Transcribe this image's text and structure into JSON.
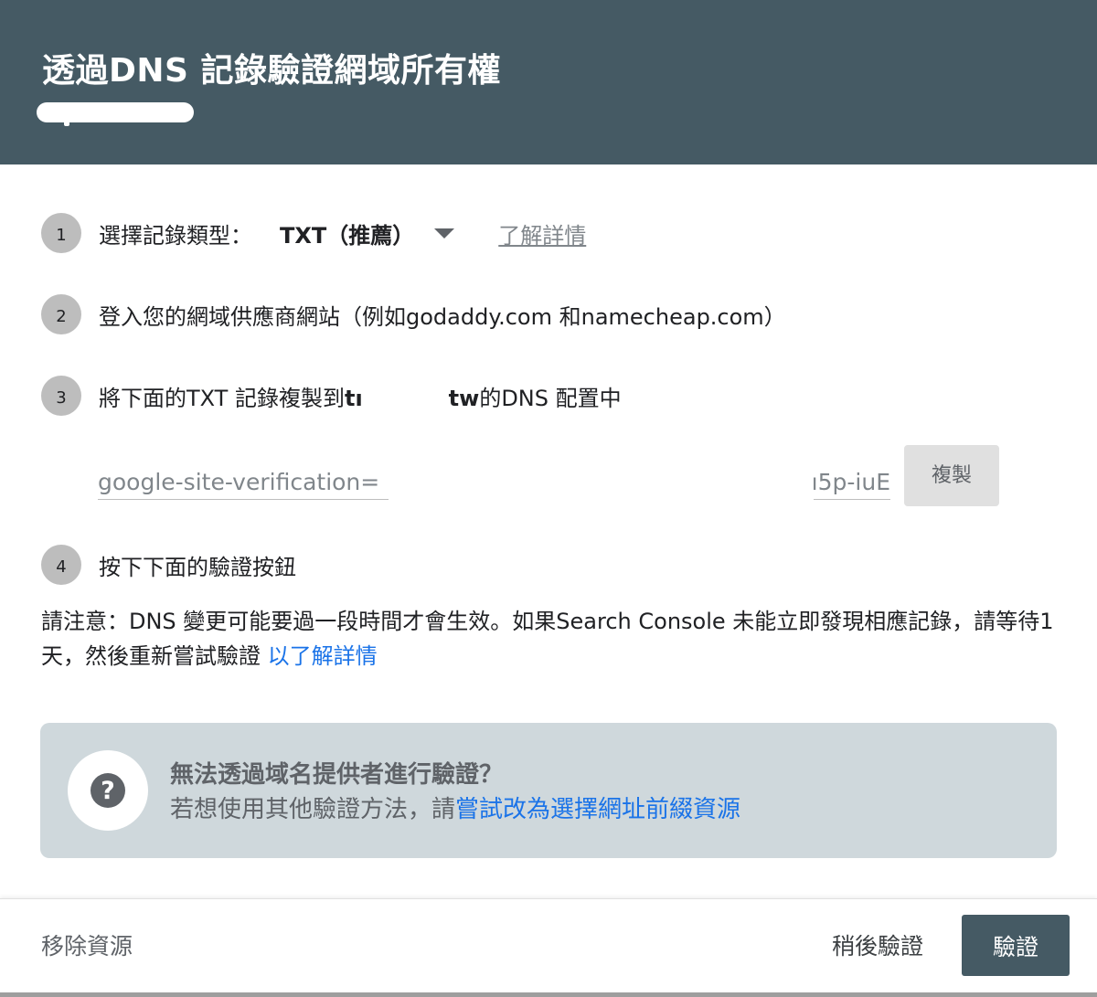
{
  "header": {
    "title": "透過DNS 記錄驗證網域所有權"
  },
  "steps": {
    "step1": {
      "number": "1",
      "label": "選擇記錄類型：",
      "record_type": "TXT（推薦）",
      "learn_more": "了解詳情"
    },
    "step2": {
      "number": "2",
      "label": "登入您的網域供應商網站（例如godaddy.com 和namecheap.com）"
    },
    "step3": {
      "number": "3",
      "label_prefix": "將下面的TXT 記錄複製到",
      "domain_start": "tı",
      "domain_end": "tw",
      "label_suffix": "的DNS 配置中",
      "record_prefix": "google-site-verification=",
      "record_suffix": "ı5p-iuE",
      "copy_label": "複製"
    },
    "step4": {
      "number": "4",
      "label": "按下下面的驗證按鈕"
    }
  },
  "note": {
    "text": "請注意：DNS 變更可能要過一段時間才會生效。如果Search Console 未能立即發現相應記錄，請等待1 天，然後重新嘗試驗證 ",
    "link": "以了解詳情"
  },
  "help": {
    "icon": "?",
    "title": "無法透過域名提供者進行驗證？",
    "body_prefix": "若想使用其他驗證方法，請",
    "body_link": "嘗試改為選擇網址前綴資源"
  },
  "footer": {
    "remove": "移除資源",
    "later": "稍後驗證",
    "verify": "驗證"
  },
  "colors": {
    "header_bg": "#455a64",
    "link": "#1a73e8",
    "help_bg": "#cfd8dc"
  }
}
